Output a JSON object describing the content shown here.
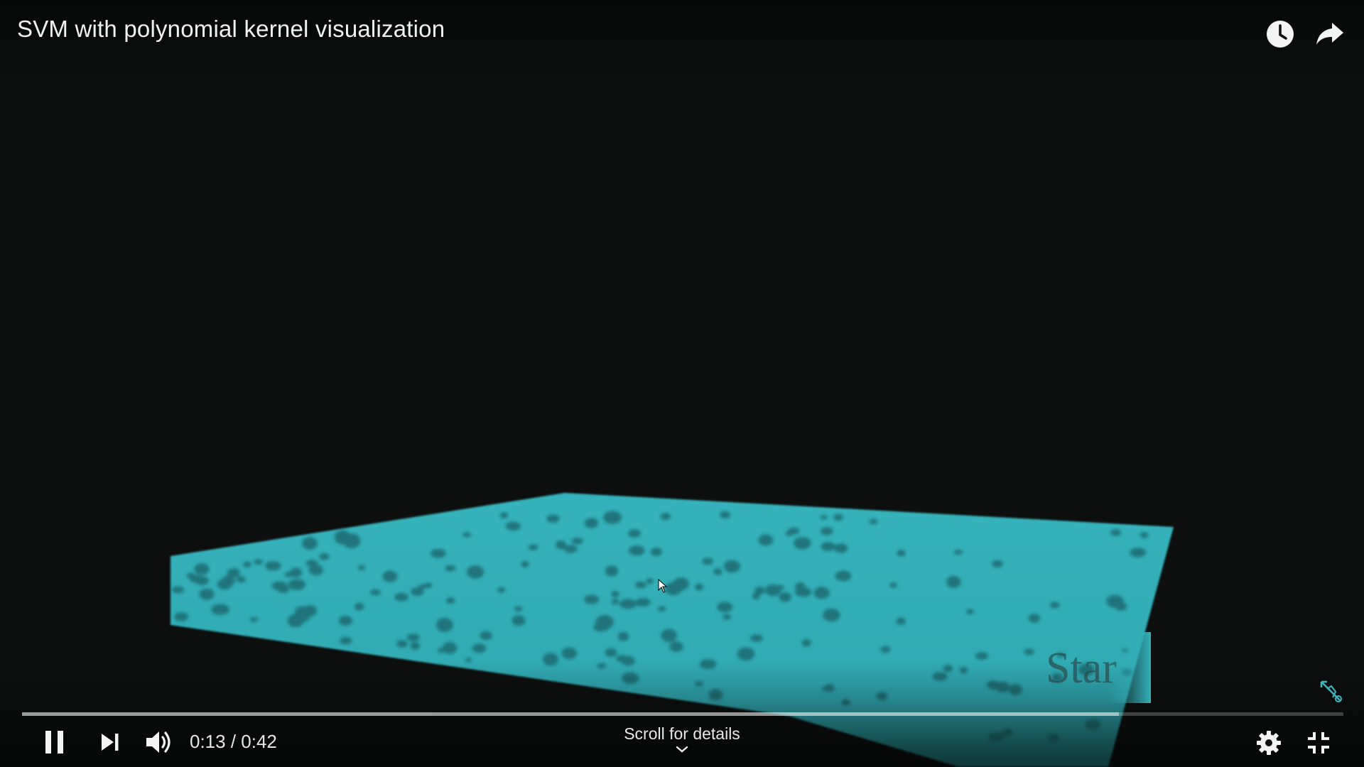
{
  "player": {
    "title": "SVM with polynomial kernel visualization",
    "current_time": "0:13",
    "duration": "0:42",
    "time_display": "0:13 / 0:42",
    "progress_fraction": 0.31,
    "buffered_fraction": 0.83,
    "scroll_hint": "Scroll for details",
    "state": "playing",
    "mode": "fullscreen"
  },
  "video_frame": {
    "watermark_text": "Star",
    "plane_color": "#33afb7",
    "background_color": "#0d0f0f"
  },
  "icons": {
    "watch_later": "clock-icon",
    "share": "share-arrow-icon",
    "pause": "pause-icon",
    "next": "skip-next-icon",
    "volume": "volume-icon",
    "scroll": "chevron-down-icon",
    "settings": "gear-icon",
    "exit_fullscreen": "exit-fullscreen-icon",
    "corner_logo": "logo-icon"
  },
  "colors": {
    "text": "#ffffff",
    "progress_track": "rgba(255,255,255,0.22)"
  }
}
